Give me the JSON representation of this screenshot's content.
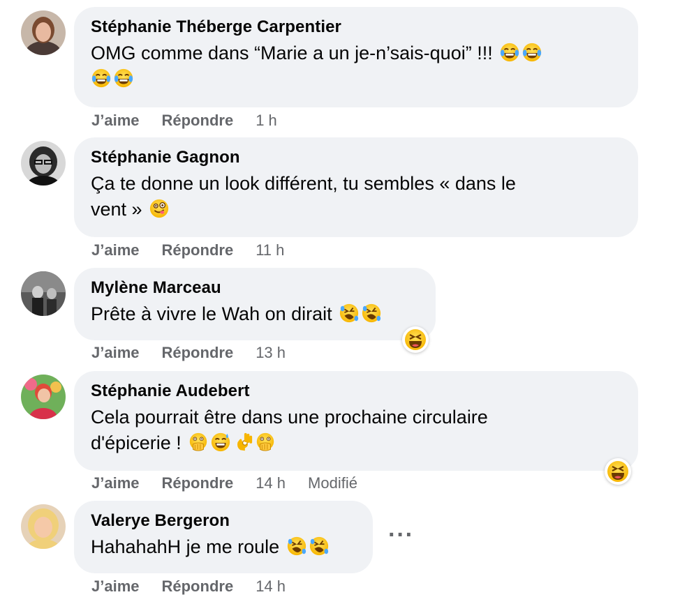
{
  "actions": {
    "like": "J’aime",
    "reply": "Répondre"
  },
  "comments": [
    {
      "author": "Stéphanie Théberge Carpentier",
      "text": "OMG comme dans “Marie a un je-n’sais-quoi” !!!",
      "time": "1 h",
      "emojis": [
        "tears-of-joy",
        "tears-of-joy",
        "tears-of-joy",
        "tears-of-joy"
      ],
      "edited": ""
    },
    {
      "author": "Stéphanie Gagnon",
      "text_line1": "Ça te donne un look différent, tu sembles « dans le",
      "text_line2": "vent »",
      "time": "11 h",
      "emojis": [
        "winking-tongue"
      ],
      "edited": ""
    },
    {
      "author": "Mylène Marceau",
      "text": "Prête à vivre le Wah on dirait",
      "time": "13 h",
      "emojis": [
        "rolling-laughing",
        "rolling-laughing"
      ],
      "reaction": "haha",
      "edited": ""
    },
    {
      "author": "Stéphanie Audebert",
      "text_line1": "Cela pourrait être dans une prochaine circulaire",
      "text_line2": "d'épicerie !",
      "time": "14 h",
      "emojis": [
        "hand-over-mouth",
        "sweat-smile",
        "ok-hand",
        "hand-over-mouth"
      ],
      "reaction": "haha",
      "edited": "Modifié"
    },
    {
      "author": "Valerye Bergeron",
      "text": "HahahahH je me roule",
      "time": "14 h",
      "emojis": [
        "rolling-laughing",
        "rolling-laughing"
      ],
      "more": "···",
      "edited": ""
    }
  ]
}
